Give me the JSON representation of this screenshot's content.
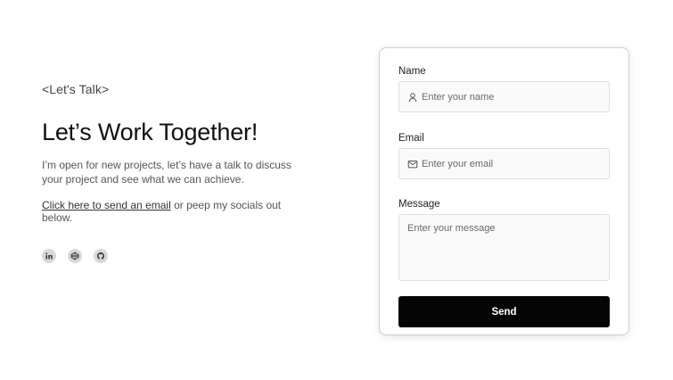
{
  "intro_section": {
    "eyebrow": "<Let's Talk>",
    "headline": "Let’s Work Together!",
    "description": "I’m open for new projects, let’s have a talk to discuss your project and see what we can achieve.",
    "cta_link": "Click here to send an email",
    "cta_rest": " or peep my socials out below.",
    "socials": [
      {
        "name": "linkedin",
        "icon": "linkedin-icon"
      },
      {
        "name": "codepen",
        "icon": "codepen-icon"
      },
      {
        "name": "github",
        "icon": "github-icon"
      }
    ]
  },
  "form": {
    "name_label": "Name",
    "name_placeholder": "Enter your name",
    "name_value": "",
    "name_icon": "user-icon",
    "email_label": "Email",
    "email_placeholder": "Enter your email",
    "email_value": "",
    "email_icon": "mail-icon",
    "message_label": "Message",
    "message_placeholder": "Enter your message",
    "message_value": "",
    "send_label": "Send"
  },
  "colors": {
    "button_bg": "#050505",
    "button_text": "#ffffff",
    "field_bg": "#fafafa",
    "social_bg": "#d9d9d9"
  }
}
